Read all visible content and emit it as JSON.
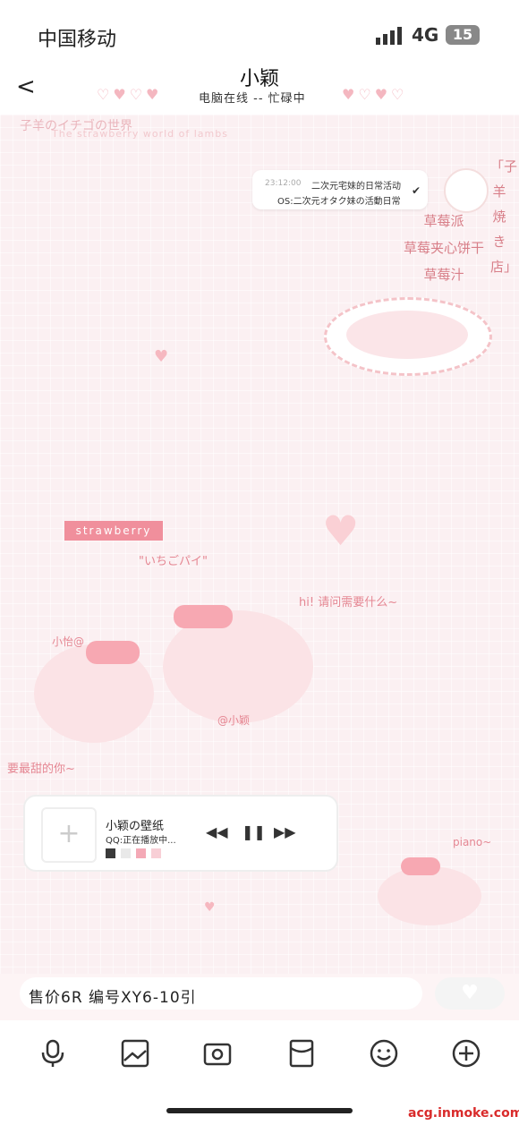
{
  "status_bar": {
    "carrier": "中国移动",
    "network": "4G",
    "battery": "15"
  },
  "header": {
    "back": "<",
    "title": "小颖",
    "hearts_left": "♡♥♡♥",
    "hearts_right": "♥♡♥♡",
    "presence": "电脑在线 -- 忙碌中"
  },
  "notification": {
    "time": "23:12:00",
    "line1": "二次元宅妹的日常活动",
    "line2": "OS:二次元オタク妹の活動日常"
  },
  "decor": {
    "title": "子羊のイチゴの世界",
    "subtitle": "The strawberry world of lambs",
    "menu": [
      "草莓派",
      "草莓夹心饼干",
      "草莓汁"
    ],
    "shop": "「子羊焼き店」",
    "strawberry_tag": "strawberry",
    "ichigo": "\"いちごパイ\"",
    "hi": "hi! 请问需要什么~",
    "sweet": "要最甜的你~",
    "at_small": "小怡@",
    "at_xiaoying": "@小颖",
    "piano": "piano~"
  },
  "player": {
    "add": "+",
    "song": "小颖の壁纸",
    "status": "QQ:正在播放中...",
    "prev": "◀◀",
    "pause": "❚❚",
    "next": "▶▶",
    "swatches": [
      "#3a3a3a",
      "#e9e9e9",
      "#f4a9b6",
      "#f8cfd6"
    ]
  },
  "input": {
    "text": "售价6R 编号XY6-10引"
  },
  "watermark": "acg.inmoke.com"
}
